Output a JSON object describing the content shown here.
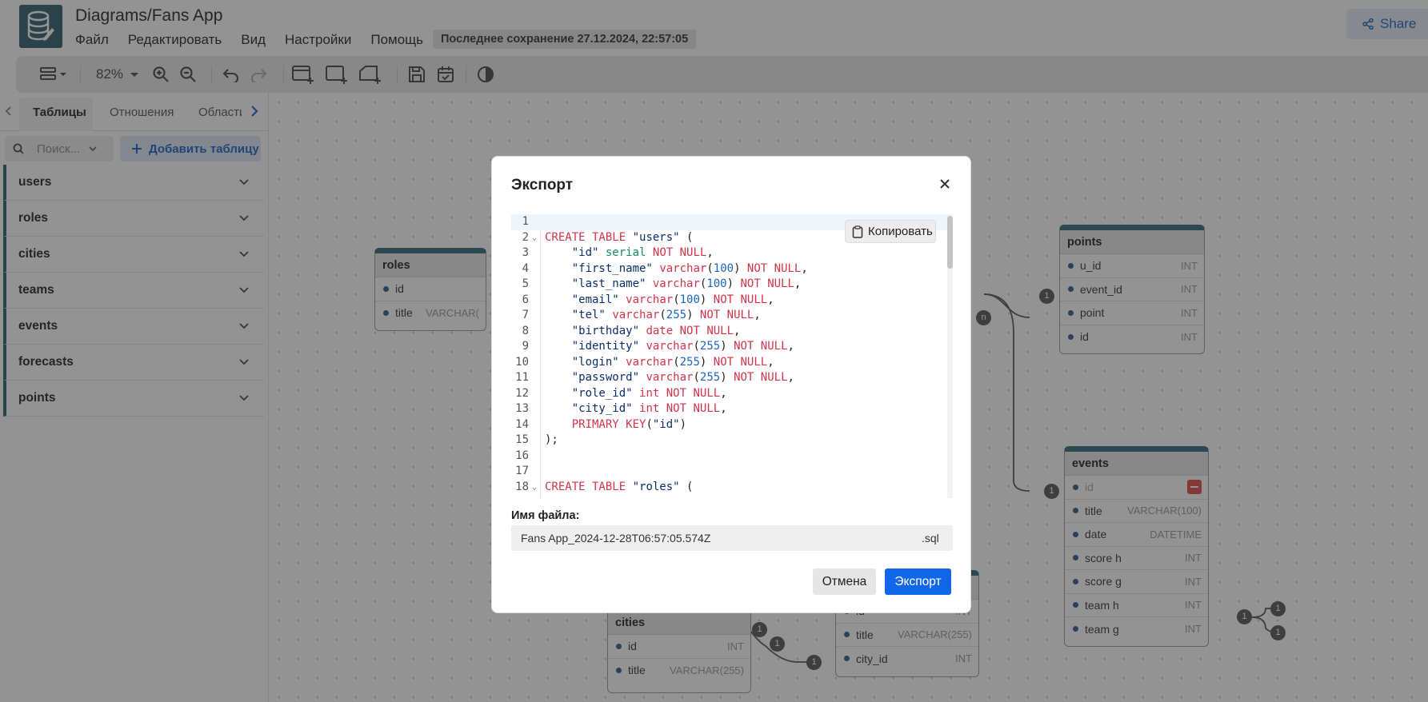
{
  "app": {
    "title": "Diagrams/Fans App",
    "menu": [
      "Файл",
      "Редактировать",
      "Вид",
      "Настройки",
      "Помощь"
    ],
    "last_save": "Последнее сохранение 27.12.2024, 22:57:05",
    "share_label": "Share"
  },
  "toolbar": {
    "zoom": "82%",
    "icons": [
      "layout-icon",
      "zoom-in-icon",
      "zoom-out-icon",
      "undo-icon",
      "redo-icon",
      "add-table-icon",
      "add-area-icon",
      "add-note-icon",
      "save-icon",
      "calendar-icon",
      "theme-icon"
    ]
  },
  "sidebar": {
    "tabs": [
      "Таблицы",
      "Отношения",
      "Области"
    ],
    "search_placeholder": "Поиск...",
    "add_table_label": "Добавить таблицу",
    "tables": [
      "users",
      "roles",
      "cities",
      "teams",
      "events",
      "forecasts",
      "points"
    ]
  },
  "canvas": {
    "roles": {
      "title": "roles",
      "rows": [
        [
          "id",
          ""
        ],
        [
          "title",
          "VARCHAR("
        ]
      ]
    },
    "points": {
      "title": "points",
      "rows": [
        [
          "u_id",
          "INT"
        ],
        [
          "event_id",
          "INT"
        ],
        [
          "point",
          "INT"
        ],
        [
          "id",
          "INT"
        ]
      ]
    },
    "events": {
      "title": "events",
      "rows": [
        [
          "id",
          ""
        ],
        [
          "title",
          "VARCHAR(100)"
        ],
        [
          "date",
          "DATETIME"
        ],
        [
          "score h",
          "INT"
        ],
        [
          "score g",
          "INT"
        ],
        [
          "team h",
          "INT"
        ],
        [
          "team g",
          "INT"
        ]
      ]
    },
    "cities": {
      "title": "cities",
      "rows": [
        [
          "id",
          "INT"
        ],
        [
          "title",
          "VARCHAR(255)"
        ]
      ]
    },
    "teams": {
      "rows": [
        [
          "id",
          "INT"
        ],
        [
          "title",
          "VARCHAR(255)"
        ],
        [
          "city_id",
          "INT"
        ]
      ]
    },
    "badges": {
      "one": "1",
      "n": "n"
    }
  },
  "modal": {
    "title": "Экспорт",
    "copy_label": "Копировать",
    "filename_label": "Имя файла:",
    "filename": "Fans App_2024-12-28T06:57:05.574Z",
    "extension": ".sql",
    "cancel_label": "Отмена",
    "export_label": "Экспорт",
    "code_lines": [
      "",
      "CREATE TABLE \"users\" (",
      "    \"id\" serial NOT NULL,",
      "    \"first_name\" varchar(100) NOT NULL,",
      "    \"last_name\" varchar(100) NOT NULL,",
      "    \"email\" varchar(100) NOT NULL,",
      "    \"tel\" varchar(255) NOT NULL,",
      "    \"birthday\" date NOT NULL,",
      "    \"identity\" varchar(255) NOT NULL,",
      "    \"login\" varchar(255) NOT NULL,",
      "    \"password\" varchar(255) NOT NULL,",
      "    \"role_id\" int NOT NULL,",
      "    \"city_id\" int NOT NULL,",
      "    PRIMARY KEY(\"id\")",
      ");",
      "",
      "",
      "CREATE TABLE \"roles\" ("
    ]
  }
}
